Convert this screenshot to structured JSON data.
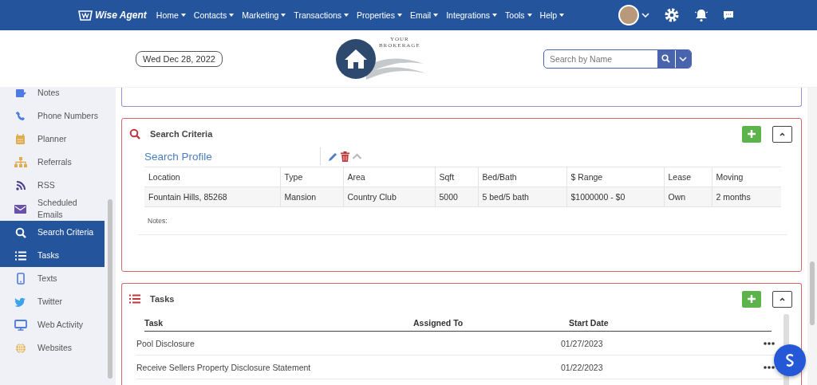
{
  "header": {
    "logo": "Wise Agent",
    "menu": [
      {
        "label": "Home"
      },
      {
        "label": "Contacts"
      },
      {
        "label": "Marketing"
      },
      {
        "label": "Transactions"
      },
      {
        "label": "Properties"
      },
      {
        "label": "Email"
      },
      {
        "label": "Integrations"
      },
      {
        "label": "Tools"
      },
      {
        "label": "Help"
      }
    ]
  },
  "topbar": {
    "date": "Wed Dec 28, 2022",
    "brokerage_logo": [
      "YOUR",
      "BROKERAGE"
    ],
    "search": {
      "placeholder": "Search by Name"
    }
  },
  "sidebar": {
    "items": [
      {
        "label": "Notes",
        "kind": "notes",
        "selected": false
      },
      {
        "label": "Phone Numbers",
        "kind": "phone",
        "selected": false
      },
      {
        "label": "Planner",
        "kind": "calendar",
        "selected": false
      },
      {
        "label": "Referrals",
        "kind": "sitemap",
        "selected": false
      },
      {
        "label": "RSS",
        "kind": "rss",
        "selected": false
      },
      {
        "label": "Scheduled Emails",
        "kind": "envelope",
        "selected": false
      },
      {
        "label": "Search Criteria",
        "kind": "search",
        "selected": true
      },
      {
        "label": "Tasks",
        "kind": "list",
        "selected": true
      },
      {
        "label": "Texts",
        "kind": "mobile",
        "selected": false
      },
      {
        "label": "Twitter",
        "kind": "bird",
        "selected": false
      },
      {
        "label": "Web Activity",
        "kind": "monitor",
        "selected": false
      },
      {
        "label": "Websites",
        "kind": "globe",
        "selected": false
      }
    ]
  },
  "search_criteria": {
    "title": "Search Criteria",
    "profile_title": "Search Profile",
    "columns": [
      "Location",
      "Type",
      "Area",
      "Sqft",
      "Bed/Bath",
      "$ Range",
      "Lease",
      "Moving"
    ],
    "rows": [
      [
        "Fountain Hills, 85268",
        "Mansion",
        "Country Club",
        "5000",
        "5 bed/5 bath",
        "$1000000 - $0",
        "Own",
        "2 months"
      ]
    ],
    "notes_label": "Notes:"
  },
  "tasks": {
    "title": "Tasks",
    "columns": [
      "Task",
      "Assigned To",
      "Start Date"
    ],
    "rows": [
      {
        "task": "Pool Disclosure",
        "start_date": "01/27/2023"
      },
      {
        "task": "Receive Sellers Property Disclosure Statement",
        "start_date": "01/22/2023"
      }
    ]
  }
}
